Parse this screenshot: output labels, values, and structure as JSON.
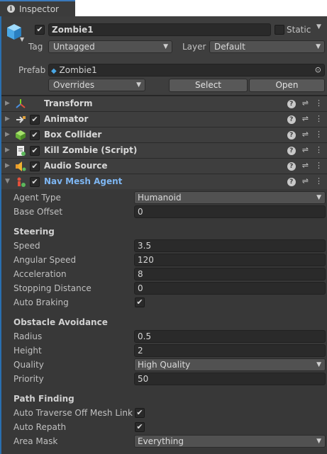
{
  "tab": {
    "label": "Inspector"
  },
  "object": {
    "name": "Zombie1",
    "active": true,
    "static_label": "Static",
    "static": false,
    "tag_label": "Tag",
    "tag_value": "Untagged",
    "layer_label": "Layer",
    "layer_value": "Default",
    "prefab_label": "Prefab",
    "prefab_value": "Zombie1",
    "overrides_label": "Overrides",
    "select_label": "Select",
    "open_label": "Open"
  },
  "components": [
    {
      "name": "Transform",
      "icon": "transform-icon",
      "has_checkbox": false
    },
    {
      "name": "Animator",
      "icon": "animator-icon",
      "has_checkbox": true
    },
    {
      "name": "Box Collider",
      "icon": "box-collider-icon",
      "has_checkbox": true
    },
    {
      "name": "Kill Zombie (Script)",
      "icon": "script-icon",
      "has_checkbox": true
    },
    {
      "name": "Audio Source",
      "icon": "audio-source-icon",
      "has_checkbox": true
    },
    {
      "name": "Nav Mesh Agent",
      "icon": "nav-mesh-agent-icon",
      "has_checkbox": true,
      "expanded": true
    }
  ],
  "nav_mesh_agent": {
    "agent_type_label": "Agent Type",
    "agent_type_value": "Humanoid",
    "base_offset_label": "Base Offset",
    "base_offset_value": "0",
    "steering_title": "Steering",
    "speed_label": "Speed",
    "speed_value": "3.5",
    "angular_speed_label": "Angular Speed",
    "angular_speed_value": "120",
    "acceleration_label": "Acceleration",
    "acceleration_value": "8",
    "stopping_distance_label": "Stopping Distance",
    "stopping_distance_value": "0",
    "auto_braking_label": "Auto Braking",
    "auto_braking": true,
    "obstacle_title": "Obstacle Avoidance",
    "radius_label": "Radius",
    "radius_value": "0.5",
    "height_label": "Height",
    "height_value": "2",
    "quality_label": "Quality",
    "quality_value": "High Quality",
    "priority_label": "Priority",
    "priority_value": "50",
    "pathfinding_title": "Path Finding",
    "auto_traverse_label": "Auto Traverse Off Mesh Link",
    "auto_traverse": true,
    "auto_repath_label": "Auto Repath",
    "auto_repath": true,
    "area_mask_label": "Area Mask",
    "area_mask_value": "Everything"
  },
  "colors": {
    "accent": "#3a79bb",
    "panel": "#383838",
    "field": "#2a2a2a",
    "highlight_text": "#7eb6f2"
  }
}
